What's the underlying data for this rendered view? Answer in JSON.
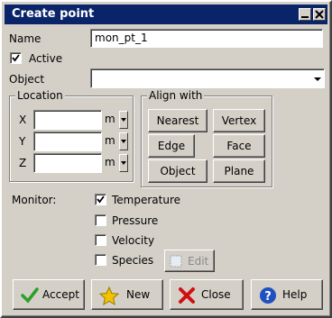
{
  "window": {
    "title": "Create point"
  },
  "name": {
    "label": "Name",
    "value": "mon_pt_1"
  },
  "active": {
    "label": "Active",
    "checked": true
  },
  "object": {
    "label": "Object",
    "value": ""
  },
  "location": {
    "title": "Location",
    "rows": [
      {
        "axis": "X",
        "value": "",
        "unit": "m"
      },
      {
        "axis": "Y",
        "value": "",
        "unit": "m"
      },
      {
        "axis": "Z",
        "value": "",
        "unit": "m"
      }
    ]
  },
  "align": {
    "title": "Align with",
    "buttons": [
      "Nearest",
      "Vertex",
      "Edge",
      "Face",
      "Object",
      "Plane"
    ]
  },
  "monitor": {
    "label": "Monitor:",
    "options": [
      {
        "label": "Temperature",
        "checked": true
      },
      {
        "label": "Pressure",
        "checked": false
      },
      {
        "label": "Velocity",
        "checked": false
      },
      {
        "label": "Species",
        "checked": false
      }
    ],
    "edit_label": "Edit"
  },
  "actions": {
    "accept": "Accept",
    "new": "New",
    "close": "Close",
    "help": "Help"
  },
  "colors": {
    "titlebar": "#0a246a",
    "face": "#d4d0c8",
    "accept_icon": "#2aa02a",
    "new_icon": "#f2c400",
    "close_icon": "#d01010",
    "help_icon": "#1f4fc0"
  }
}
